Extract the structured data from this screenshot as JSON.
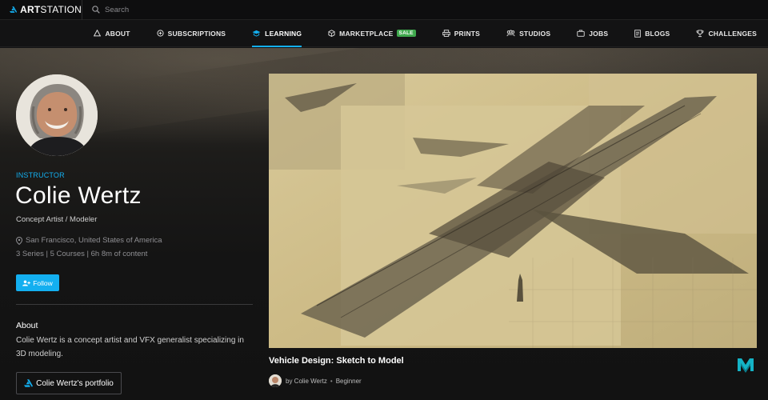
{
  "app": {
    "logo_text_bold": "ART",
    "logo_text_rest": "STATION",
    "search_placeholder": "Search"
  },
  "nav": {
    "items": [
      {
        "label": "ABOUT",
        "icon": "about-icon"
      },
      {
        "label": "SUBSCRIPTIONS",
        "icon": "subscriptions-icon"
      },
      {
        "label": "LEARNING",
        "icon": "learning-icon",
        "active": true
      },
      {
        "label": "MARKETPLACE",
        "icon": "marketplace-icon",
        "badge": "SALE"
      },
      {
        "label": "PRINTS",
        "icon": "prints-icon"
      },
      {
        "label": "STUDIOS",
        "icon": "studios-icon"
      },
      {
        "label": "JOBS",
        "icon": "jobs-icon"
      },
      {
        "label": "BLOGS",
        "icon": "blogs-icon"
      },
      {
        "label": "CHALLENGES",
        "icon": "challenges-icon"
      }
    ]
  },
  "instructor": {
    "role": "INSTRUCTOR",
    "name": "Colie Wertz",
    "title": "Concept Artist / Modeler",
    "location": "San Francisco, United States of America",
    "stats": "3 Series | 5 Courses | 6h 8m of content",
    "follow_label": "Follow",
    "about_heading": "About",
    "about_text": "Colie Wertz is a concept artist and VFX generalist specializing in 3D modeling.",
    "portfolio_label": "Colie Wertz's portfolio"
  },
  "course": {
    "title": "Vehicle Design: Sketch to Model",
    "by": "by Colie Wertz",
    "separator": "•",
    "level": "Beginner"
  },
  "colors": {
    "accent": "#13aff0",
    "sale": "#3fa84d",
    "background": "#131314"
  }
}
